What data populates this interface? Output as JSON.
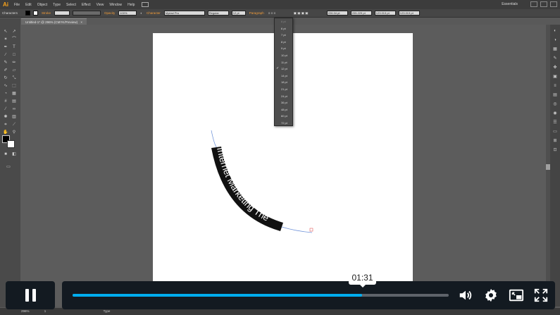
{
  "app": {
    "logo": "Ai",
    "menu": [
      "File",
      "Edit",
      "Object",
      "Type",
      "Select",
      "Effect",
      "View",
      "Window",
      "Help"
    ],
    "workspace": "Essentials"
  },
  "control_bar": {
    "panel_name": "Characters",
    "stroke_label": "Stroke",
    "opacity_label": "Opacity",
    "opacity_value": "100%",
    "character_label": "Character",
    "font_family": "Myriad Pro",
    "font_style": "Regular",
    "font_size": "12 pt",
    "paragraph_label": "Paragraph",
    "x_value": "226.04 pt",
    "y_value": "205.229 pt",
    "w_value": "123.013 pt",
    "h_value": "123.013 pt"
  },
  "document": {
    "tab_title": "Untitled-1* @ 296% (CMYK/Preview)",
    "close": "×",
    "path_text": "Internet Marketing The"
  },
  "font_size_menu": {
    "first": "6 pt",
    "items": [
      "6 pt",
      "7 pt",
      "8 pt",
      "9 pt",
      "10 pt",
      "11 pt",
      "12 pt",
      "14 pt",
      "18 pt",
      "21 pt",
      "24 pt",
      "36 pt",
      "48 pt",
      "60 pt",
      "72 pt"
    ],
    "selected": "12 pt"
  },
  "status_bar": {
    "zoom": "296%",
    "page": "1",
    "tool": "Type"
  },
  "video": {
    "timestamp": "01:31",
    "progress": 0.77,
    "accent": "#00adef"
  },
  "icons": [
    "pause-icon",
    "volume-icon",
    "settings-icon",
    "picture-in-picture-icon",
    "fullscreen-icon"
  ]
}
